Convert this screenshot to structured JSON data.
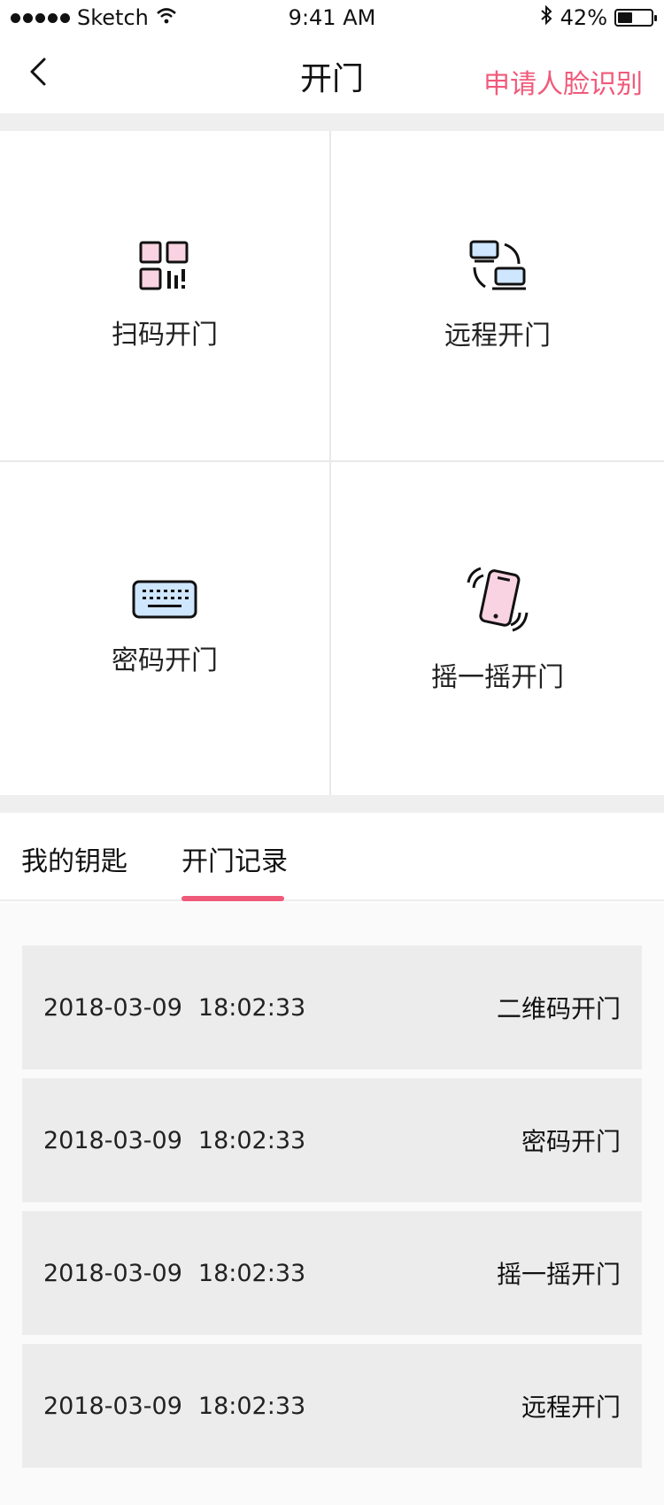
{
  "status_bar": {
    "carrier": "Sketch",
    "time": "9:41 AM",
    "battery": "42%",
    "battery_level": 0.42
  },
  "nav": {
    "title": "开门",
    "action": "申请人脸识别",
    "accent_color": "#f05a7a"
  },
  "grid": {
    "items": [
      {
        "label": "扫码开门",
        "icon": "qr-code-icon"
      },
      {
        "label": "远程开门",
        "icon": "remote-devices-icon"
      },
      {
        "label": "密码开门",
        "icon": "keyboard-icon"
      },
      {
        "label": "摇一摇开门",
        "icon": "shake-phone-icon"
      }
    ]
  },
  "tabs": {
    "items": [
      {
        "label": "我的钥匙",
        "active": false
      },
      {
        "label": "开门记录",
        "active": true
      }
    ]
  },
  "records": [
    {
      "date": "2018-03-09",
      "time": "18:02:33",
      "type": "二维码开门"
    },
    {
      "date": "2018-03-09",
      "time": "18:02:33",
      "type": "密码开门"
    },
    {
      "date": "2018-03-09",
      "time": "18:02:33",
      "type": "摇一摇开门"
    },
    {
      "date": "2018-03-09",
      "time": "18:02:33",
      "type": "远程开门"
    }
  ]
}
